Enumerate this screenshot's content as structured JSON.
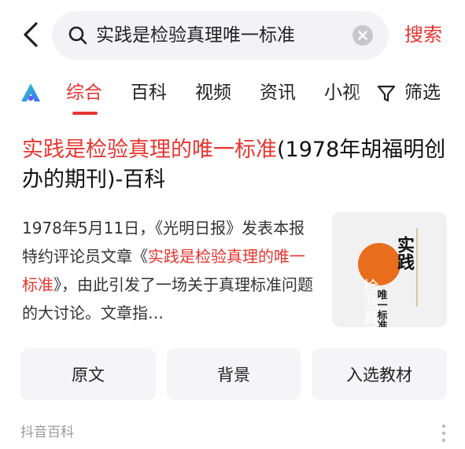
{
  "search": {
    "query": "实践是检验真理唯一标准",
    "button_label": "搜索"
  },
  "tabs": {
    "items": [
      "综合",
      "百科",
      "视频",
      "资讯",
      "小视"
    ],
    "active": "综合",
    "filter_label": "筛选"
  },
  "result": {
    "title_highlight": "实践是检验真理的唯一标准",
    "title_rest": "(1978年胡福明创办的期刊)-百科",
    "desc_part1": "1978年5月11日，《光明日报》发表本报特约评论员文章《",
    "desc_highlight": "实践是检验真理的唯一标准",
    "desc_part2": "》，由此引发了一场关于真理标准问题的大讨论。文章指…",
    "thumb_main": "实践",
    "thumb_side": "检测真理的",
    "thumb_bottom": "唯一标准"
  },
  "actions": [
    "原文",
    "背景",
    "入选教材"
  ],
  "source": "抖音百科",
  "colors": {
    "accent": "#e8352f",
    "search_bg": "#f3f3f5",
    "button_bg": "#f5f5f7"
  }
}
